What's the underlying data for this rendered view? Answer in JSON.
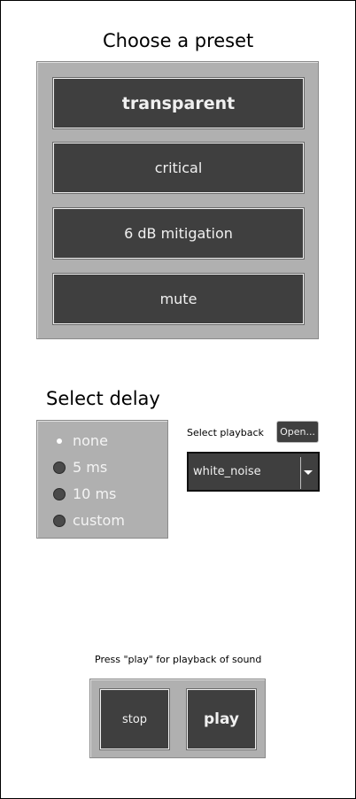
{
  "preset": {
    "heading": "Choose a preset",
    "buttons": [
      {
        "label": "transparent",
        "active": true
      },
      {
        "label": "critical"
      },
      {
        "label": "6 dB mitigation"
      },
      {
        "label": "mute"
      }
    ]
  },
  "delay": {
    "heading": "Select delay",
    "options": [
      {
        "label": "none",
        "selected": true
      },
      {
        "label": "5 ms"
      },
      {
        "label": "10 ms"
      },
      {
        "label": "custom"
      }
    ]
  },
  "playback": {
    "label": "Select playback",
    "open_label": "Open...",
    "selected_value": "white_noise"
  },
  "transport": {
    "hint": "Press \"play\" for playback of sound",
    "stop_label": "stop",
    "play_label": "play"
  }
}
